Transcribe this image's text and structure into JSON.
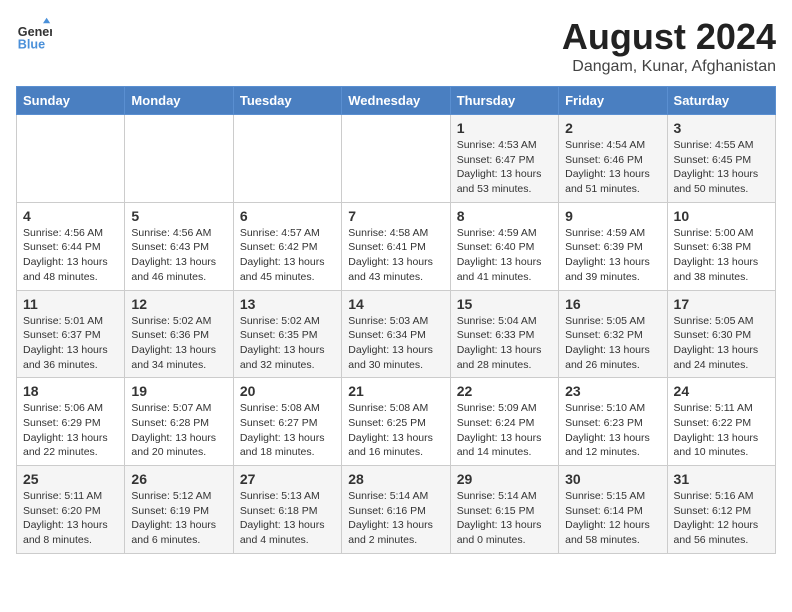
{
  "header": {
    "logo_line1": "General",
    "logo_line2": "Blue",
    "title": "August 2024",
    "subtitle": "Dangam, Kunar, Afghanistan"
  },
  "days_of_week": [
    "Sunday",
    "Monday",
    "Tuesday",
    "Wednesday",
    "Thursday",
    "Friday",
    "Saturday"
  ],
  "weeks": [
    [
      {
        "day": "",
        "info": ""
      },
      {
        "day": "",
        "info": ""
      },
      {
        "day": "",
        "info": ""
      },
      {
        "day": "",
        "info": ""
      },
      {
        "day": "1",
        "info": "Sunrise: 4:53 AM\nSunset: 6:47 PM\nDaylight: 13 hours\nand 53 minutes."
      },
      {
        "day": "2",
        "info": "Sunrise: 4:54 AM\nSunset: 6:46 PM\nDaylight: 13 hours\nand 51 minutes."
      },
      {
        "day": "3",
        "info": "Sunrise: 4:55 AM\nSunset: 6:45 PM\nDaylight: 13 hours\nand 50 minutes."
      }
    ],
    [
      {
        "day": "4",
        "info": "Sunrise: 4:56 AM\nSunset: 6:44 PM\nDaylight: 13 hours\nand 48 minutes."
      },
      {
        "day": "5",
        "info": "Sunrise: 4:56 AM\nSunset: 6:43 PM\nDaylight: 13 hours\nand 46 minutes."
      },
      {
        "day": "6",
        "info": "Sunrise: 4:57 AM\nSunset: 6:42 PM\nDaylight: 13 hours\nand 45 minutes."
      },
      {
        "day": "7",
        "info": "Sunrise: 4:58 AM\nSunset: 6:41 PM\nDaylight: 13 hours\nand 43 minutes."
      },
      {
        "day": "8",
        "info": "Sunrise: 4:59 AM\nSunset: 6:40 PM\nDaylight: 13 hours\nand 41 minutes."
      },
      {
        "day": "9",
        "info": "Sunrise: 4:59 AM\nSunset: 6:39 PM\nDaylight: 13 hours\nand 39 minutes."
      },
      {
        "day": "10",
        "info": "Sunrise: 5:00 AM\nSunset: 6:38 PM\nDaylight: 13 hours\nand 38 minutes."
      }
    ],
    [
      {
        "day": "11",
        "info": "Sunrise: 5:01 AM\nSunset: 6:37 PM\nDaylight: 13 hours\nand 36 minutes."
      },
      {
        "day": "12",
        "info": "Sunrise: 5:02 AM\nSunset: 6:36 PM\nDaylight: 13 hours\nand 34 minutes."
      },
      {
        "day": "13",
        "info": "Sunrise: 5:02 AM\nSunset: 6:35 PM\nDaylight: 13 hours\nand 32 minutes."
      },
      {
        "day": "14",
        "info": "Sunrise: 5:03 AM\nSunset: 6:34 PM\nDaylight: 13 hours\nand 30 minutes."
      },
      {
        "day": "15",
        "info": "Sunrise: 5:04 AM\nSunset: 6:33 PM\nDaylight: 13 hours\nand 28 minutes."
      },
      {
        "day": "16",
        "info": "Sunrise: 5:05 AM\nSunset: 6:32 PM\nDaylight: 13 hours\nand 26 minutes."
      },
      {
        "day": "17",
        "info": "Sunrise: 5:05 AM\nSunset: 6:30 PM\nDaylight: 13 hours\nand 24 minutes."
      }
    ],
    [
      {
        "day": "18",
        "info": "Sunrise: 5:06 AM\nSunset: 6:29 PM\nDaylight: 13 hours\nand 22 minutes."
      },
      {
        "day": "19",
        "info": "Sunrise: 5:07 AM\nSunset: 6:28 PM\nDaylight: 13 hours\nand 20 minutes."
      },
      {
        "day": "20",
        "info": "Sunrise: 5:08 AM\nSunset: 6:27 PM\nDaylight: 13 hours\nand 18 minutes."
      },
      {
        "day": "21",
        "info": "Sunrise: 5:08 AM\nSunset: 6:25 PM\nDaylight: 13 hours\nand 16 minutes."
      },
      {
        "day": "22",
        "info": "Sunrise: 5:09 AM\nSunset: 6:24 PM\nDaylight: 13 hours\nand 14 minutes."
      },
      {
        "day": "23",
        "info": "Sunrise: 5:10 AM\nSunset: 6:23 PM\nDaylight: 13 hours\nand 12 minutes."
      },
      {
        "day": "24",
        "info": "Sunrise: 5:11 AM\nSunset: 6:22 PM\nDaylight: 13 hours\nand 10 minutes."
      }
    ],
    [
      {
        "day": "25",
        "info": "Sunrise: 5:11 AM\nSunset: 6:20 PM\nDaylight: 13 hours\nand 8 minutes."
      },
      {
        "day": "26",
        "info": "Sunrise: 5:12 AM\nSunset: 6:19 PM\nDaylight: 13 hours\nand 6 minutes."
      },
      {
        "day": "27",
        "info": "Sunrise: 5:13 AM\nSunset: 6:18 PM\nDaylight: 13 hours\nand 4 minutes."
      },
      {
        "day": "28",
        "info": "Sunrise: 5:14 AM\nSunset: 6:16 PM\nDaylight: 13 hours\nand 2 minutes."
      },
      {
        "day": "29",
        "info": "Sunrise: 5:14 AM\nSunset: 6:15 PM\nDaylight: 13 hours\nand 0 minutes."
      },
      {
        "day": "30",
        "info": "Sunrise: 5:15 AM\nSunset: 6:14 PM\nDaylight: 12 hours\nand 58 minutes."
      },
      {
        "day": "31",
        "info": "Sunrise: 5:16 AM\nSunset: 6:12 PM\nDaylight: 12 hours\nand 56 minutes."
      }
    ]
  ]
}
